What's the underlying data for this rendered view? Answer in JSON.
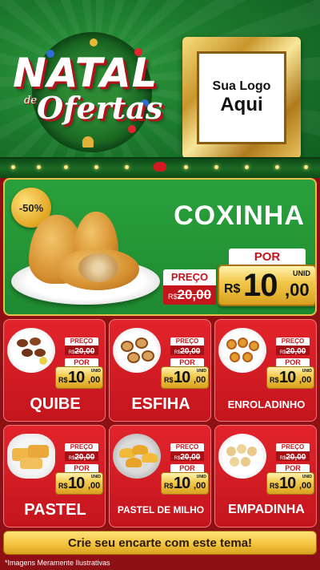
{
  "header": {
    "title_natal": "NATAL",
    "title_de": "de",
    "title_ofertas": "Ofertas",
    "logo_line1": "Sua Logo",
    "logo_line2": "Aqui"
  },
  "hero": {
    "discount": "-50%",
    "name": "COXINHA",
    "preco_label": "PREÇO",
    "old_currency": "R$",
    "old_value": "20,00",
    "por_label": "POR",
    "currency": "R$",
    "price_int": "10",
    "price_dec": ",00",
    "unit": "UNID"
  },
  "products": [
    {
      "name": "QUIBE",
      "preco_label": "PREÇO",
      "old_currency": "R$",
      "old_value": "20,00",
      "por_label": "POR",
      "currency": "R$",
      "price_int": "10",
      "price_dec": ",00",
      "unit": "UNID"
    },
    {
      "name": "ESFIHA",
      "preco_label": "PREÇO",
      "old_currency": "R$",
      "old_value": "20,00",
      "por_label": "POR",
      "currency": "R$",
      "price_int": "10",
      "price_dec": ",00",
      "unit": "UNID"
    },
    {
      "name": "ENROLADINHO",
      "preco_label": "PREÇO",
      "old_currency": "R$",
      "old_value": "20,00",
      "por_label": "POR",
      "currency": "R$",
      "price_int": "10",
      "price_dec": ",00",
      "unit": "UNID"
    },
    {
      "name": "PASTEL",
      "preco_label": "PREÇO",
      "old_currency": "R$",
      "old_value": "20,00",
      "por_label": "POR",
      "currency": "R$",
      "price_int": "10",
      "price_dec": ",00",
      "unit": "UNID"
    },
    {
      "name": "PASTEL DE MILHO",
      "preco_label": "PREÇO",
      "old_currency": "R$",
      "old_value": "20,00",
      "por_label": "POR",
      "currency": "R$",
      "price_int": "10",
      "price_dec": ",00",
      "unit": "UNID"
    },
    {
      "name": "EMPADINHA",
      "preco_label": "PREÇO",
      "old_currency": "R$",
      "old_value": "20,00",
      "por_label": "POR",
      "currency": "R$",
      "price_int": "10",
      "price_dec": ",00",
      "unit": "UNID"
    }
  ],
  "footer": {
    "cta": "Crie seu encarte com este tema!",
    "disclaimer": "*Imagens Meramente Ilustrativas"
  },
  "colors": {
    "header_green": "#1b7a2c",
    "card_red": "#c4151d",
    "gold": "#f2c94c",
    "background": "#8e0f14"
  }
}
